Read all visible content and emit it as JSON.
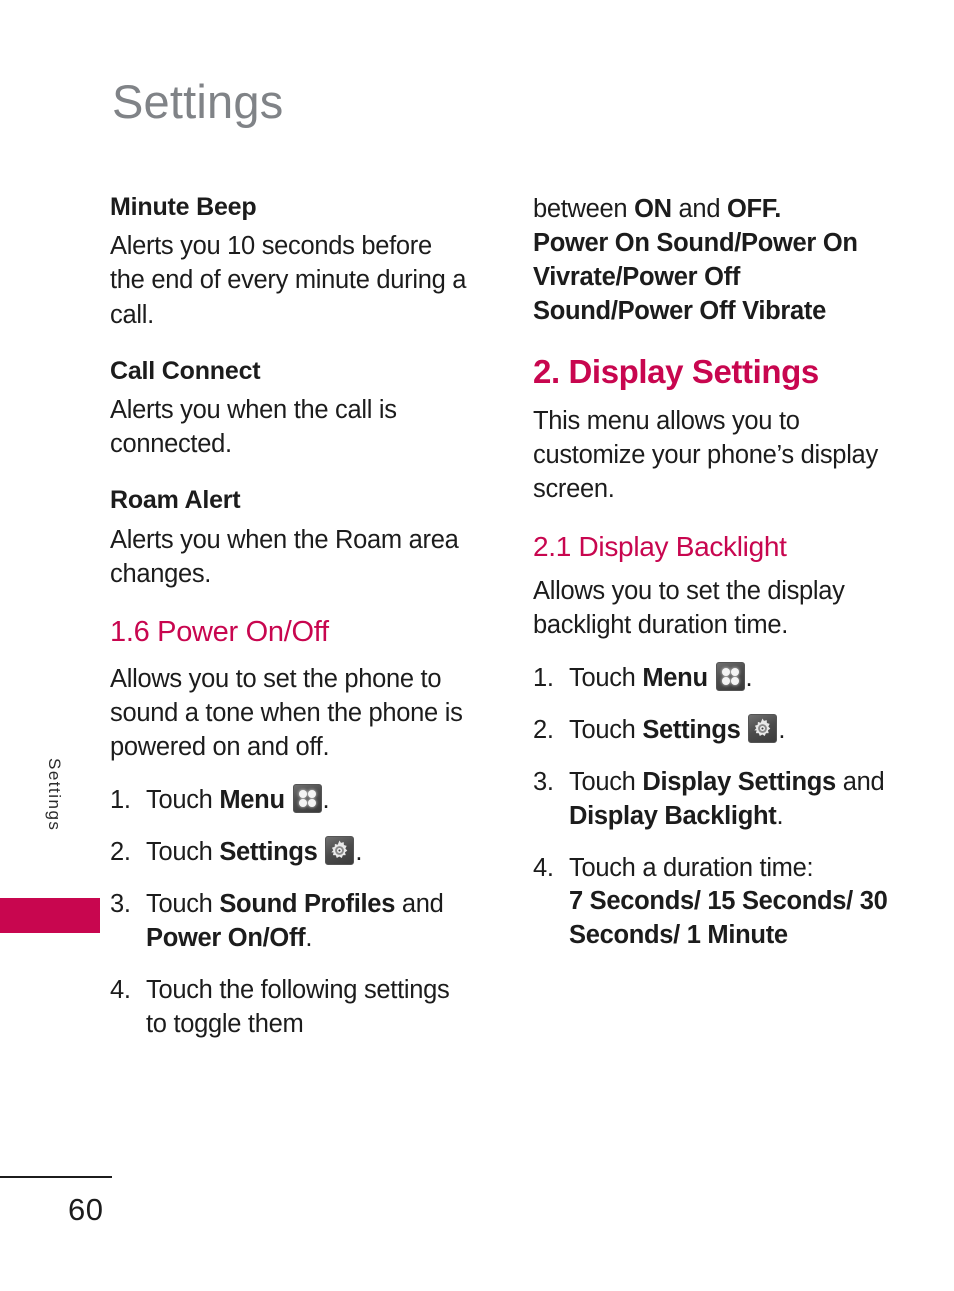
{
  "page": {
    "title": "Settings",
    "side_tab_label": "Settings",
    "page_number": "60",
    "accent_color": "#c8064f",
    "title_color": "#808387"
  },
  "icons": {
    "menu": "menu-grid-icon",
    "settings": "gear-icon"
  },
  "left_column": {
    "minute_beep_head": "Minute Beep",
    "minute_beep_body": "Alerts you 10 seconds before the end of every minute during a call.",
    "call_connect_head": "Call Connect",
    "call_connect_body": "Alerts you when the call is connected.",
    "roam_alert_head": "Roam Alert",
    "roam_alert_body": "Alerts you when the Roam area changes.",
    "power_onoff_head": "1.6 Power On/Off",
    "power_onoff_body": "Allows you to set the phone to sound a tone when the phone is powered on and off.",
    "steps": [
      {
        "num": "1.",
        "pre": "Touch ",
        "bold": "Menu",
        "post": "",
        "icon": "menu",
        "tail": "."
      },
      {
        "num": "2.",
        "pre": "Touch ",
        "bold": "Settings",
        "post": "",
        "icon": "settings",
        "tail": "."
      },
      {
        "num": "3.",
        "pre": "Touch ",
        "bold": "Sound Profiles",
        "mid": " and ",
        "bold2": "Power On/Off",
        "tail": "."
      },
      {
        "num": "4.",
        "pre": "Touch the following settings to toggle them",
        "tail": ""
      }
    ]
  },
  "right_column": {
    "continued_plain": "between ",
    "continued_bold_on": "ON",
    "continued_mid": " and ",
    "continued_bold_off": "OFF.",
    "continued_bold_block": "Power On Sound/Power On Vivrate/Power Off Sound/Power Off Vibrate",
    "display_settings_head": "2. Display Settings",
    "display_settings_body": "This menu allows you to customize your phone’s display screen.",
    "display_backlight_head": "2.1 Display Backlight",
    "display_backlight_body": "Allows you to set the display backlight duration time.",
    "steps": [
      {
        "num": "1.",
        "pre": "Touch ",
        "bold": "Menu",
        "icon": "menu",
        "tail": "."
      },
      {
        "num": "2.",
        "pre": "Touch ",
        "bold": "Settings",
        "icon": "settings",
        "tail": "."
      },
      {
        "num": "3.",
        "pre": "Touch ",
        "bold": "Display Settings",
        "mid": " and ",
        "bold2": "Display Backlight",
        "tail": "."
      },
      {
        "num": "4.",
        "pre": "Touch a duration time:",
        "bold": "7 Seconds/ 15 Seconds/ 30 Seconds/ 1 Minute",
        "tail": ""
      }
    ]
  }
}
